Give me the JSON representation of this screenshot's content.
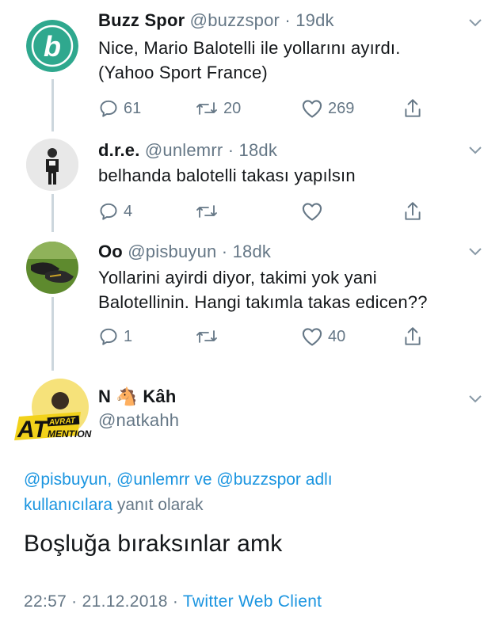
{
  "tweets": [
    {
      "name": "Buzz Spor",
      "handle": "@buzzspor",
      "sep": "·",
      "time": "19dk",
      "lines": [
        "Nice, Mario Balotelli ile yollarını ayırdı.",
        "(Yahoo Sport France)"
      ],
      "replies": "61",
      "retweets": "20",
      "likes": "269",
      "avatar_icon": "buzz-spor-logo",
      "avatar_letter": "b",
      "brand_color": "#2fa88e"
    },
    {
      "name": "d.r.e.",
      "handle": "@unlemrr",
      "sep": "·",
      "time": "18dk",
      "lines": [
        "belhanda balotelli takası yapılsın"
      ],
      "replies": "4",
      "retweets": "",
      "likes": "",
      "avatar_icon": "person-photo"
    },
    {
      "name": "Oo",
      "handle": "@pisbuyun",
      "sep": "·",
      "time": "18dk",
      "lines": [
        "Yollarini ayirdi diyor, takimi yok yani",
        "Balotellinin. Hangi takımla takas edicen??"
      ],
      "replies": "1",
      "retweets": "",
      "likes": "40",
      "avatar_icon": "football-boots-photo"
    }
  ],
  "main_tweet": {
    "name_part1": "N",
    "name_emoji": "🐴",
    "name_part2": "Kâh",
    "handle": "@natkahh",
    "avatar_text_big": "AT",
    "avatar_text_top": "AVRAT",
    "avatar_text_bottom": "MENTION",
    "reply_mentions": "@pisbuyun, @unlemrr ve @buzzspor adlı",
    "reply_mentions_line2": "kullanıcılara",
    "reply_suffix": "yanıt olarak",
    "text": "Boşluğa bıraksınlar amk",
    "timestamp": "22:57 · 21.12.2018 ·",
    "client": "Twitter Web Client"
  },
  "colors": {
    "accent": "#1b95e0",
    "muted": "#657786",
    "text": "#14171a",
    "thread_line": "#ccd6dd"
  }
}
